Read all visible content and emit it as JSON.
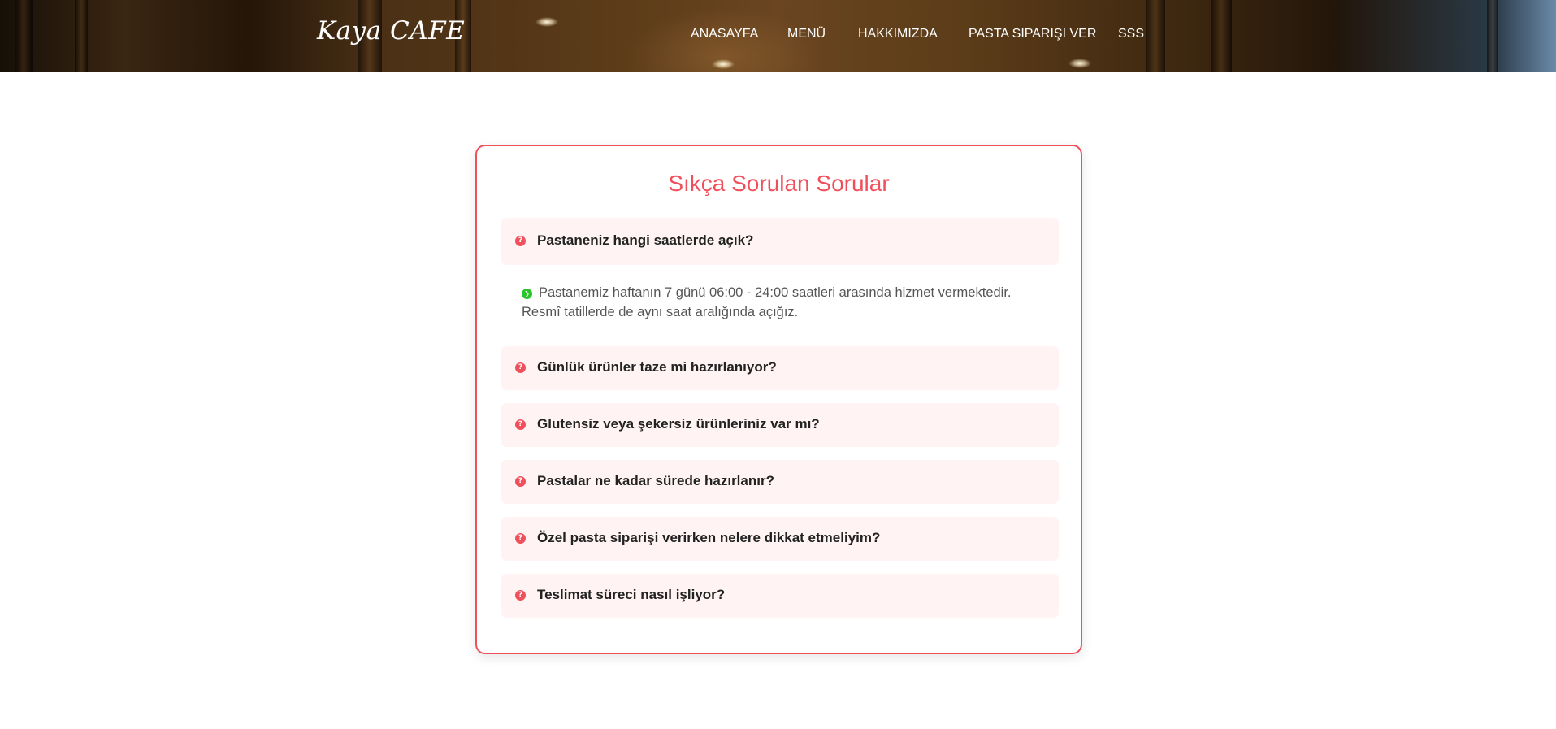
{
  "header": {
    "logo": "Kaya CAFE",
    "nav": [
      {
        "label": "ANASAYFA"
      },
      {
        "label": "MENÜ"
      },
      {
        "label": "HAKKIMIZDA"
      },
      {
        "label": "PASTA SIPARIŞI VER"
      },
      {
        "label": "SSS"
      }
    ]
  },
  "faq": {
    "title": "Sıkça Sorulan Sorular",
    "questions": [
      {
        "question": "Pastaneniz hangi saatlerde açık?",
        "expanded": true,
        "answer_line1": "Pastanemiz haftanın 7 günü 06:00 - 24:00 saatleri arasında hizmet vermektedir.",
        "answer_line2": "Resmî tatillerde de aynı saat aralığında açığız."
      },
      {
        "question": "Günlük ürünler taze mi hazırlanıyor?",
        "expanded": false
      },
      {
        "question": "Glutensiz veya şekersiz ürünleriniz var mı?",
        "expanded": false
      },
      {
        "question": "Pastalar ne kadar sürede hazırlanır?",
        "expanded": false
      },
      {
        "question": "Özel pasta siparişi verirken nelere dikkat etmeliyim?",
        "expanded": false
      },
      {
        "question": "Teslimat süreci nasıl işliyor?",
        "expanded": false
      }
    ]
  },
  "icons": {
    "question_icon": "question-circle-icon",
    "answer_icon": "chevron-right-circle-icon"
  },
  "colors": {
    "accent": "#f0505c",
    "question_bg": "#fff4f3",
    "answer_icon": "#2ac52a",
    "answer_text": "#555555"
  }
}
